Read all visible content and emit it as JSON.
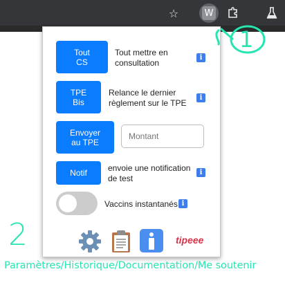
{
  "browser": {
    "extension_badge": "W"
  },
  "popup": {
    "rows": [
      {
        "button": "Tout\nCS",
        "description": "Tout mettre en\nconsultation"
      },
      {
        "button": "TPE\nBis",
        "description": "Relance le dernier\nrèglement sur le TPE"
      },
      {
        "button": "Envoyer\nau TPE",
        "amount_placeholder": "Montant"
      },
      {
        "button": "Notif",
        "description": "envoie une notification\nde test"
      }
    ],
    "vaccins_label": "Vaccins instantanés",
    "vaccins_enabled": false,
    "info_glyph": "i",
    "tipeee_label": "tipeee"
  },
  "annotations": {
    "marker_1": "1",
    "marker_2": "2",
    "caption": "Paramètres/Historique/Documentation/Me soutenir",
    "color": "#27e5b0"
  }
}
